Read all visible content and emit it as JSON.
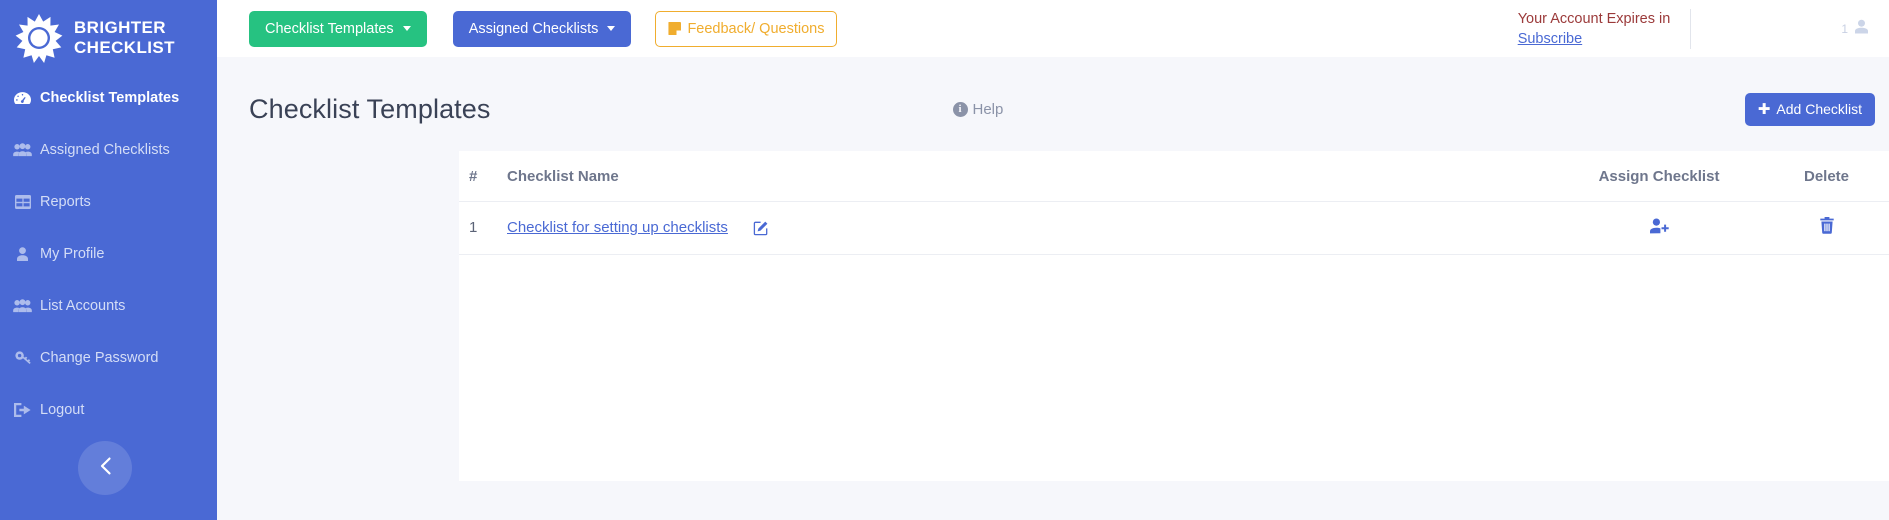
{
  "brand": {
    "logo_icon": "sun-icon",
    "line1": "BRIGHTER",
    "line2": "CHECKLIST"
  },
  "sidebar": {
    "background_color": "#4a69d4",
    "items": [
      {
        "label": "Checklist Templates",
        "icon": "tachometer-icon",
        "active": true
      },
      {
        "label": "Assigned Checklists",
        "icon": "users-icon",
        "active": false
      },
      {
        "label": "Reports",
        "icon": "table-icon",
        "active": false
      },
      {
        "label": "My Profile",
        "icon": "user-icon",
        "active": false
      },
      {
        "label": "List Accounts",
        "icon": "users-icon",
        "active": false
      },
      {
        "label": "Change Password",
        "icon": "key-icon",
        "active": false
      },
      {
        "label": "Logout",
        "icon": "sign-out-icon",
        "active": false
      }
    ],
    "collapse_icon": "chevron-left-icon"
  },
  "topbar": {
    "checklist_templates_button": "Checklist Templates",
    "assigned_checklists_button": "Assigned Checklists",
    "feedback_button": "Feedback/ Questions",
    "feedback_icon": "note-icon",
    "expiry_text": "Your Account Expires in",
    "subscribe_link": "Subscribe",
    "user_count": "1",
    "user_icon": "user-avatar-icon",
    "colors": {
      "green": "#26c281",
      "blue": "#4a69d4",
      "orange": "#f0ad2e",
      "expiry_red": "#9b3a3a"
    }
  },
  "page": {
    "title": "Checklist Templates",
    "help_label": "Help",
    "help_icon": "info-icon",
    "add_button": "Add Checklist",
    "add_icon": "plus-icon"
  },
  "table": {
    "columns": [
      "#",
      "Checklist Name",
      "Assign Checklist",
      "Delete"
    ],
    "rows": [
      {
        "num": "1",
        "name": "Checklist for setting up checklists",
        "edit_icon": "edit-pencil-icon",
        "assign_icon": "user-plus-icon",
        "delete_icon": "trash-icon"
      }
    ]
  }
}
